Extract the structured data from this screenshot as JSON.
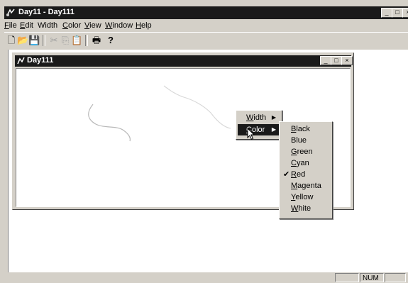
{
  "app": {
    "title": "Day11 - Day111",
    "caption_buttons": [
      "_",
      "□",
      "×"
    ]
  },
  "menubar": {
    "items": [
      {
        "label": "File",
        "mnemonic": "F",
        "rest": "ile"
      },
      {
        "label": "Edit",
        "mnemonic": "E",
        "rest": "dit"
      },
      {
        "label": "Width",
        "mnemonic": "",
        "rest": "Width"
      },
      {
        "label": "Color",
        "mnemonic": "C",
        "rest": "olor"
      },
      {
        "label": "View",
        "mnemonic": "V",
        "rest": "iew"
      },
      {
        "label": "Window",
        "mnemonic": "W",
        "rest": "indow"
      },
      {
        "label": "Help",
        "mnemonic": "H",
        "rest": "elp"
      }
    ]
  },
  "toolbar": {
    "buttons": [
      {
        "icon": "new-icon",
        "glyph": "🗋",
        "enabled": true
      },
      {
        "icon": "open-icon",
        "glyph": "📂",
        "enabled": true
      },
      {
        "icon": "save-icon",
        "glyph": "💾",
        "enabled": true
      },
      {
        "icon": "cut-icon",
        "glyph": "✂",
        "enabled": false
      },
      {
        "icon": "copy-icon",
        "glyph": "⎘",
        "enabled": false
      },
      {
        "icon": "paste-icon",
        "glyph": "📋",
        "enabled": false
      },
      {
        "icon": "print-icon",
        "glyph": "🖶",
        "enabled": true
      },
      {
        "icon": "help-icon",
        "glyph": "?",
        "enabled": true
      }
    ]
  },
  "child_window": {
    "title": "Day111",
    "caption_buttons": [
      "_",
      "□",
      "×"
    ]
  },
  "context_menu": {
    "items": [
      {
        "label": "Width",
        "mnemonic": "W",
        "rest": "idth",
        "has_submenu": true,
        "selected": false
      },
      {
        "label": "Color",
        "mnemonic": "C",
        "rest": "olor",
        "has_submenu": true,
        "selected": true
      }
    ]
  },
  "color_submenu": {
    "items": [
      {
        "label": "Black",
        "mnemonic": "B",
        "rest": "lack",
        "checked": false
      },
      {
        "label": "Blue",
        "mnemonic": "",
        "rest": "Blue",
        "checked": false
      },
      {
        "label": "Green",
        "mnemonic": "G",
        "rest": "reen",
        "checked": false
      },
      {
        "label": "Cyan",
        "mnemonic": "C",
        "rest": "yan",
        "checked": false
      },
      {
        "label": "Red",
        "mnemonic": "R",
        "rest": "ed",
        "checked": true
      },
      {
        "label": "Magenta",
        "mnemonic": "M",
        "rest": "agenta",
        "checked": false
      },
      {
        "label": "Yellow",
        "mnemonic": "Y",
        "rest": "ellow",
        "checked": false
      },
      {
        "label": "White",
        "mnemonic": "W",
        "rest": "hite",
        "checked": false
      }
    ]
  },
  "statusbar": {
    "num": "NUM"
  },
  "colors": {
    "face": "#d4d0c8",
    "titlebar": "#1a1a1a",
    "highlight": "#1a1a1a"
  }
}
